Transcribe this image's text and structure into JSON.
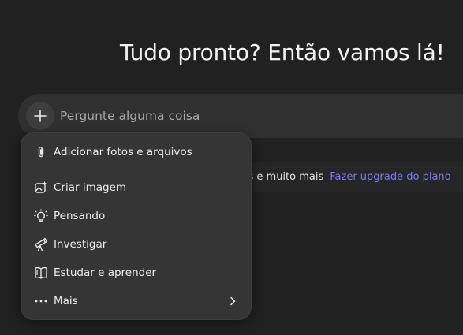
{
  "headline": "Tudo pronto? Então vamos lá!",
  "composer": {
    "placeholder": "Pergunte alguma coisa"
  },
  "promo": {
    "text": "gens e muito mais",
    "link": "Fazer upgrade do plano"
  },
  "menu": {
    "items": [
      {
        "label": "Adicionar fotos e arquivos",
        "icon": "paperclip-icon"
      },
      {
        "label": "Criar imagem",
        "icon": "image-sparkle-icon"
      },
      {
        "label": "Pensando",
        "icon": "lightbulb-icon"
      },
      {
        "label": "Investigar",
        "icon": "telescope-icon"
      },
      {
        "label": "Estudar e aprender",
        "icon": "open-book-icon"
      },
      {
        "label": "Mais",
        "icon": "more-dots-icon"
      }
    ]
  },
  "colors": {
    "background": "#212121",
    "composer": "#303030",
    "menu": "#353535",
    "link": "#7b7bf5"
  }
}
